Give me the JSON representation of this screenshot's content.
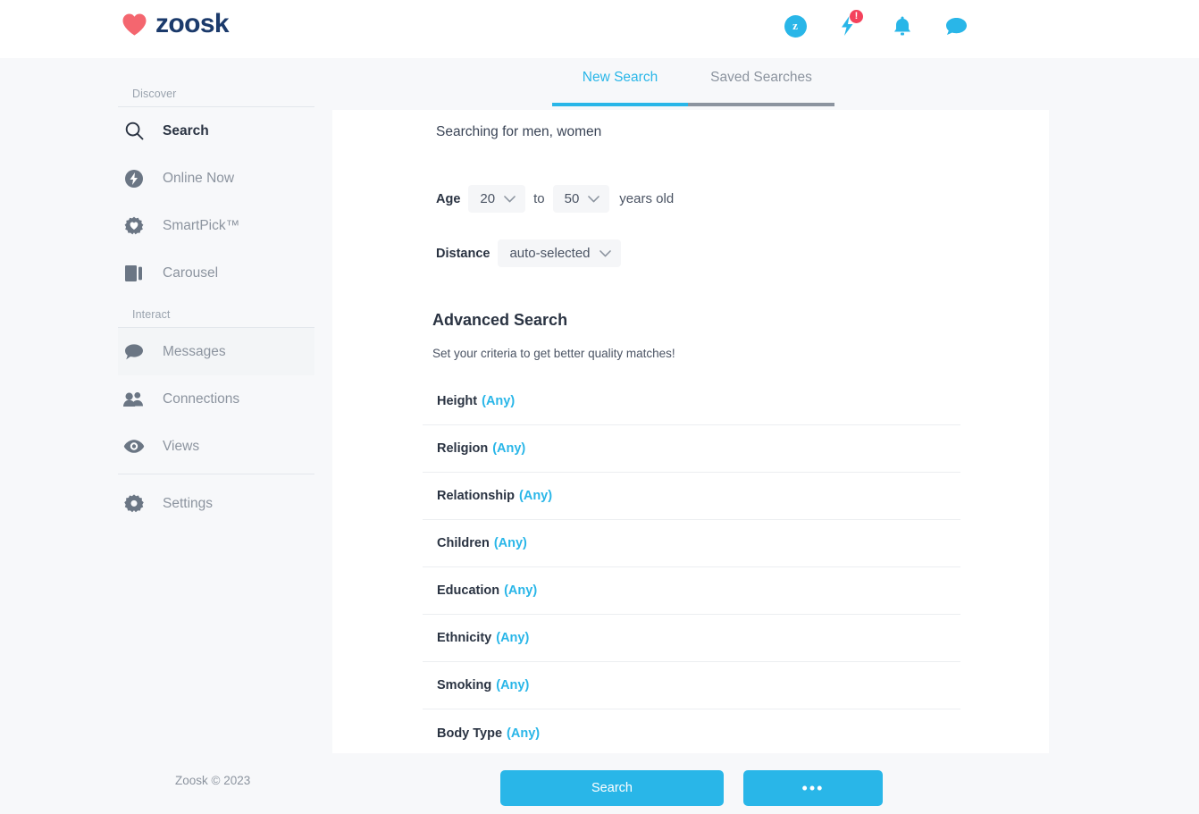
{
  "header": {
    "logo_text": "zoosk",
    "icons": [
      {
        "name": "profile-avatar",
        "label": "z",
        "badge": null
      },
      {
        "name": "boost-lightning-icon",
        "label": "",
        "badge": "!"
      },
      {
        "name": "notifications-bell-icon",
        "label": "",
        "badge": null
      },
      {
        "name": "messages-chat-icon",
        "label": "",
        "badge": null
      }
    ]
  },
  "sidebar": {
    "group_discover_label": "Discover",
    "group_interact_label": "Interact",
    "discover_items": [
      {
        "label": "Search",
        "icon": "search-icon",
        "active": true,
        "tinted": false
      },
      {
        "label": "Online Now",
        "icon": "lightning-circle-icon",
        "active": false,
        "tinted": false
      },
      {
        "label": "SmartPick™",
        "icon": "heart-gear-icon",
        "active": false,
        "tinted": false
      },
      {
        "label": "Carousel",
        "icon": "carousel-cards-icon",
        "active": false,
        "tinted": false
      }
    ],
    "interact_items": [
      {
        "label": "Messages",
        "icon": "chat-bubble-icon",
        "active": false,
        "tinted": true
      },
      {
        "label": "Connections",
        "icon": "people-icon",
        "active": false,
        "tinted": false
      },
      {
        "label": "Views",
        "icon": "eye-icon",
        "active": false,
        "tinted": false
      }
    ],
    "settings_items": [
      {
        "label": "Settings",
        "icon": "gear-icon",
        "active": false,
        "tinted": false
      }
    ]
  },
  "tabs": [
    {
      "label": "New Search",
      "active": true
    },
    {
      "label": "Saved Searches",
      "active": false
    }
  ],
  "search_form": {
    "searching_for": "Searching for men, women",
    "age_label": "Age",
    "age_min": "20",
    "age_to": "to",
    "age_max": "50",
    "age_suffix": "years old",
    "distance_label": "Distance",
    "distance_value": "auto-selected"
  },
  "advanced": {
    "title": "Advanced Search",
    "subtitle": "Set your criteria to get better quality matches!",
    "criteria": [
      {
        "name": "Height",
        "value": "(Any)"
      },
      {
        "name": "Religion",
        "value": "(Any)"
      },
      {
        "name": "Relationship",
        "value": "(Any)"
      },
      {
        "name": "Children",
        "value": "(Any)"
      },
      {
        "name": "Education",
        "value": "(Any)"
      },
      {
        "name": "Ethnicity",
        "value": "(Any)"
      },
      {
        "name": "Smoking",
        "value": "(Any)"
      },
      {
        "name": "Body Type",
        "value": "(Any)"
      }
    ]
  },
  "footer": {
    "copyright": "Zoosk © 2023",
    "search_button": "Search",
    "more_button": "•••"
  },
  "colors": {
    "accent_blue": "#29b6e8",
    "logo_navy": "#1b3a6b",
    "heart_red": "#f4666f",
    "badge_red": "#f4425c",
    "page_bg": "#f7f8fa",
    "panel_bg": "#ffffff",
    "muted_text": "#8c949f",
    "dark_text": "#2a3342"
  }
}
